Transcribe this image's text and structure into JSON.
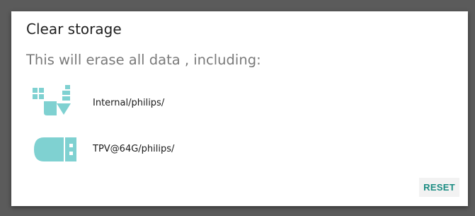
{
  "dialog": {
    "title": "Clear storage",
    "message": "This will erase all data , including:",
    "items": [
      {
        "icon": "internal-storage-icon",
        "label": "Internal/philips/"
      },
      {
        "icon": "usb-drive-icon",
        "label": "TPV@64G/philips/"
      }
    ],
    "reset_label": "RESET"
  },
  "colors": {
    "accent": "#1b8c82",
    "icon": "#7fd1d1",
    "overlay": "#5b5b5b"
  }
}
